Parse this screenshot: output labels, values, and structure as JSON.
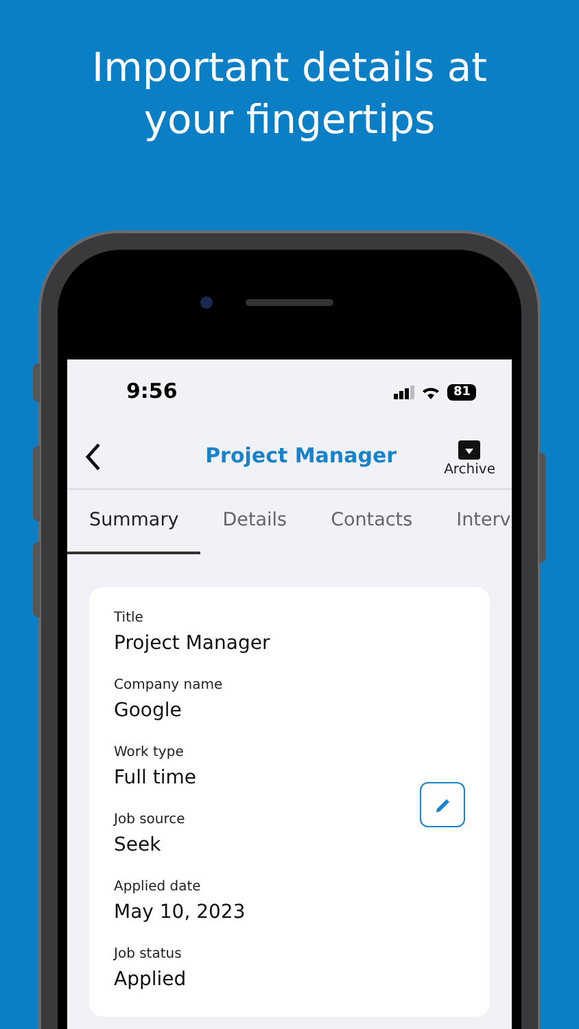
{
  "headline": "Important details at your fingertips",
  "status_bar": {
    "time": "9:56",
    "battery": "81"
  },
  "header": {
    "title": "Project Manager",
    "action": "Archive"
  },
  "tabs": [
    {
      "label": "Summary",
      "selected": true
    },
    {
      "label": "Details",
      "selected": false
    },
    {
      "label": "Contacts",
      "selected": false
    },
    {
      "label": "Interv",
      "selected": false
    }
  ],
  "fields": [
    {
      "label": "Title",
      "value": "Project Manager"
    },
    {
      "label": "Company name",
      "value": "Google"
    },
    {
      "label": "Work type",
      "value": "Full time"
    },
    {
      "label": "Job source",
      "value": "Seek"
    },
    {
      "label": "Applied date",
      "value": "May 10, 2023"
    },
    {
      "label": "Job status",
      "value": "Applied"
    }
  ]
}
